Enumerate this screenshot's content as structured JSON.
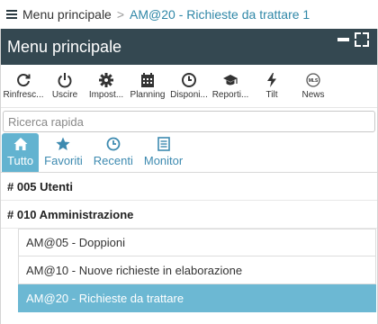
{
  "breadcrumb": {
    "home": "Menu principale",
    "separator": ">",
    "current": "AM@20 - Richieste da trattare 1"
  },
  "header": {
    "title": "Menu principale"
  },
  "toolbar": [
    {
      "label": "Rinfresc...",
      "icon": "refresh-icon"
    },
    {
      "label": "Uscire",
      "icon": "power-icon"
    },
    {
      "label": "Impost...",
      "icon": "gear-icon"
    },
    {
      "label": "Planning",
      "icon": "calendar-icon"
    },
    {
      "label": "Disponi...",
      "icon": "clock-icon"
    },
    {
      "label": "Reporti...",
      "icon": "graduation-cap-icon"
    },
    {
      "label": "Tilt",
      "icon": "lightning-icon"
    },
    {
      "label": "News",
      "icon": "news-icon"
    }
  ],
  "search": {
    "placeholder": "Ricerca rapida",
    "value": ""
  },
  "tabs": [
    {
      "label": "Tutto",
      "icon": "home-icon",
      "active": true
    },
    {
      "label": "Favoriti",
      "icon": "star-icon",
      "active": false
    },
    {
      "label": "Recenti",
      "icon": "clock-icon",
      "active": false
    },
    {
      "label": "Monitor",
      "icon": "list-icon",
      "active": false
    }
  ],
  "sections": [
    {
      "label": "# 005 Utenti",
      "items": []
    },
    {
      "label": "# 010 Amministrazione",
      "items": [
        {
          "label": "AM@05 - Doppioni",
          "selected": false
        },
        {
          "label": "AM@10 - Nuove richieste in elaborazione",
          "selected": false
        },
        {
          "label": "AM@20 - Richieste da trattare",
          "selected": true
        }
      ]
    }
  ],
  "colors": {
    "header_bg": "#344851",
    "accent": "#63b3d0",
    "link": "#2f87a7"
  }
}
